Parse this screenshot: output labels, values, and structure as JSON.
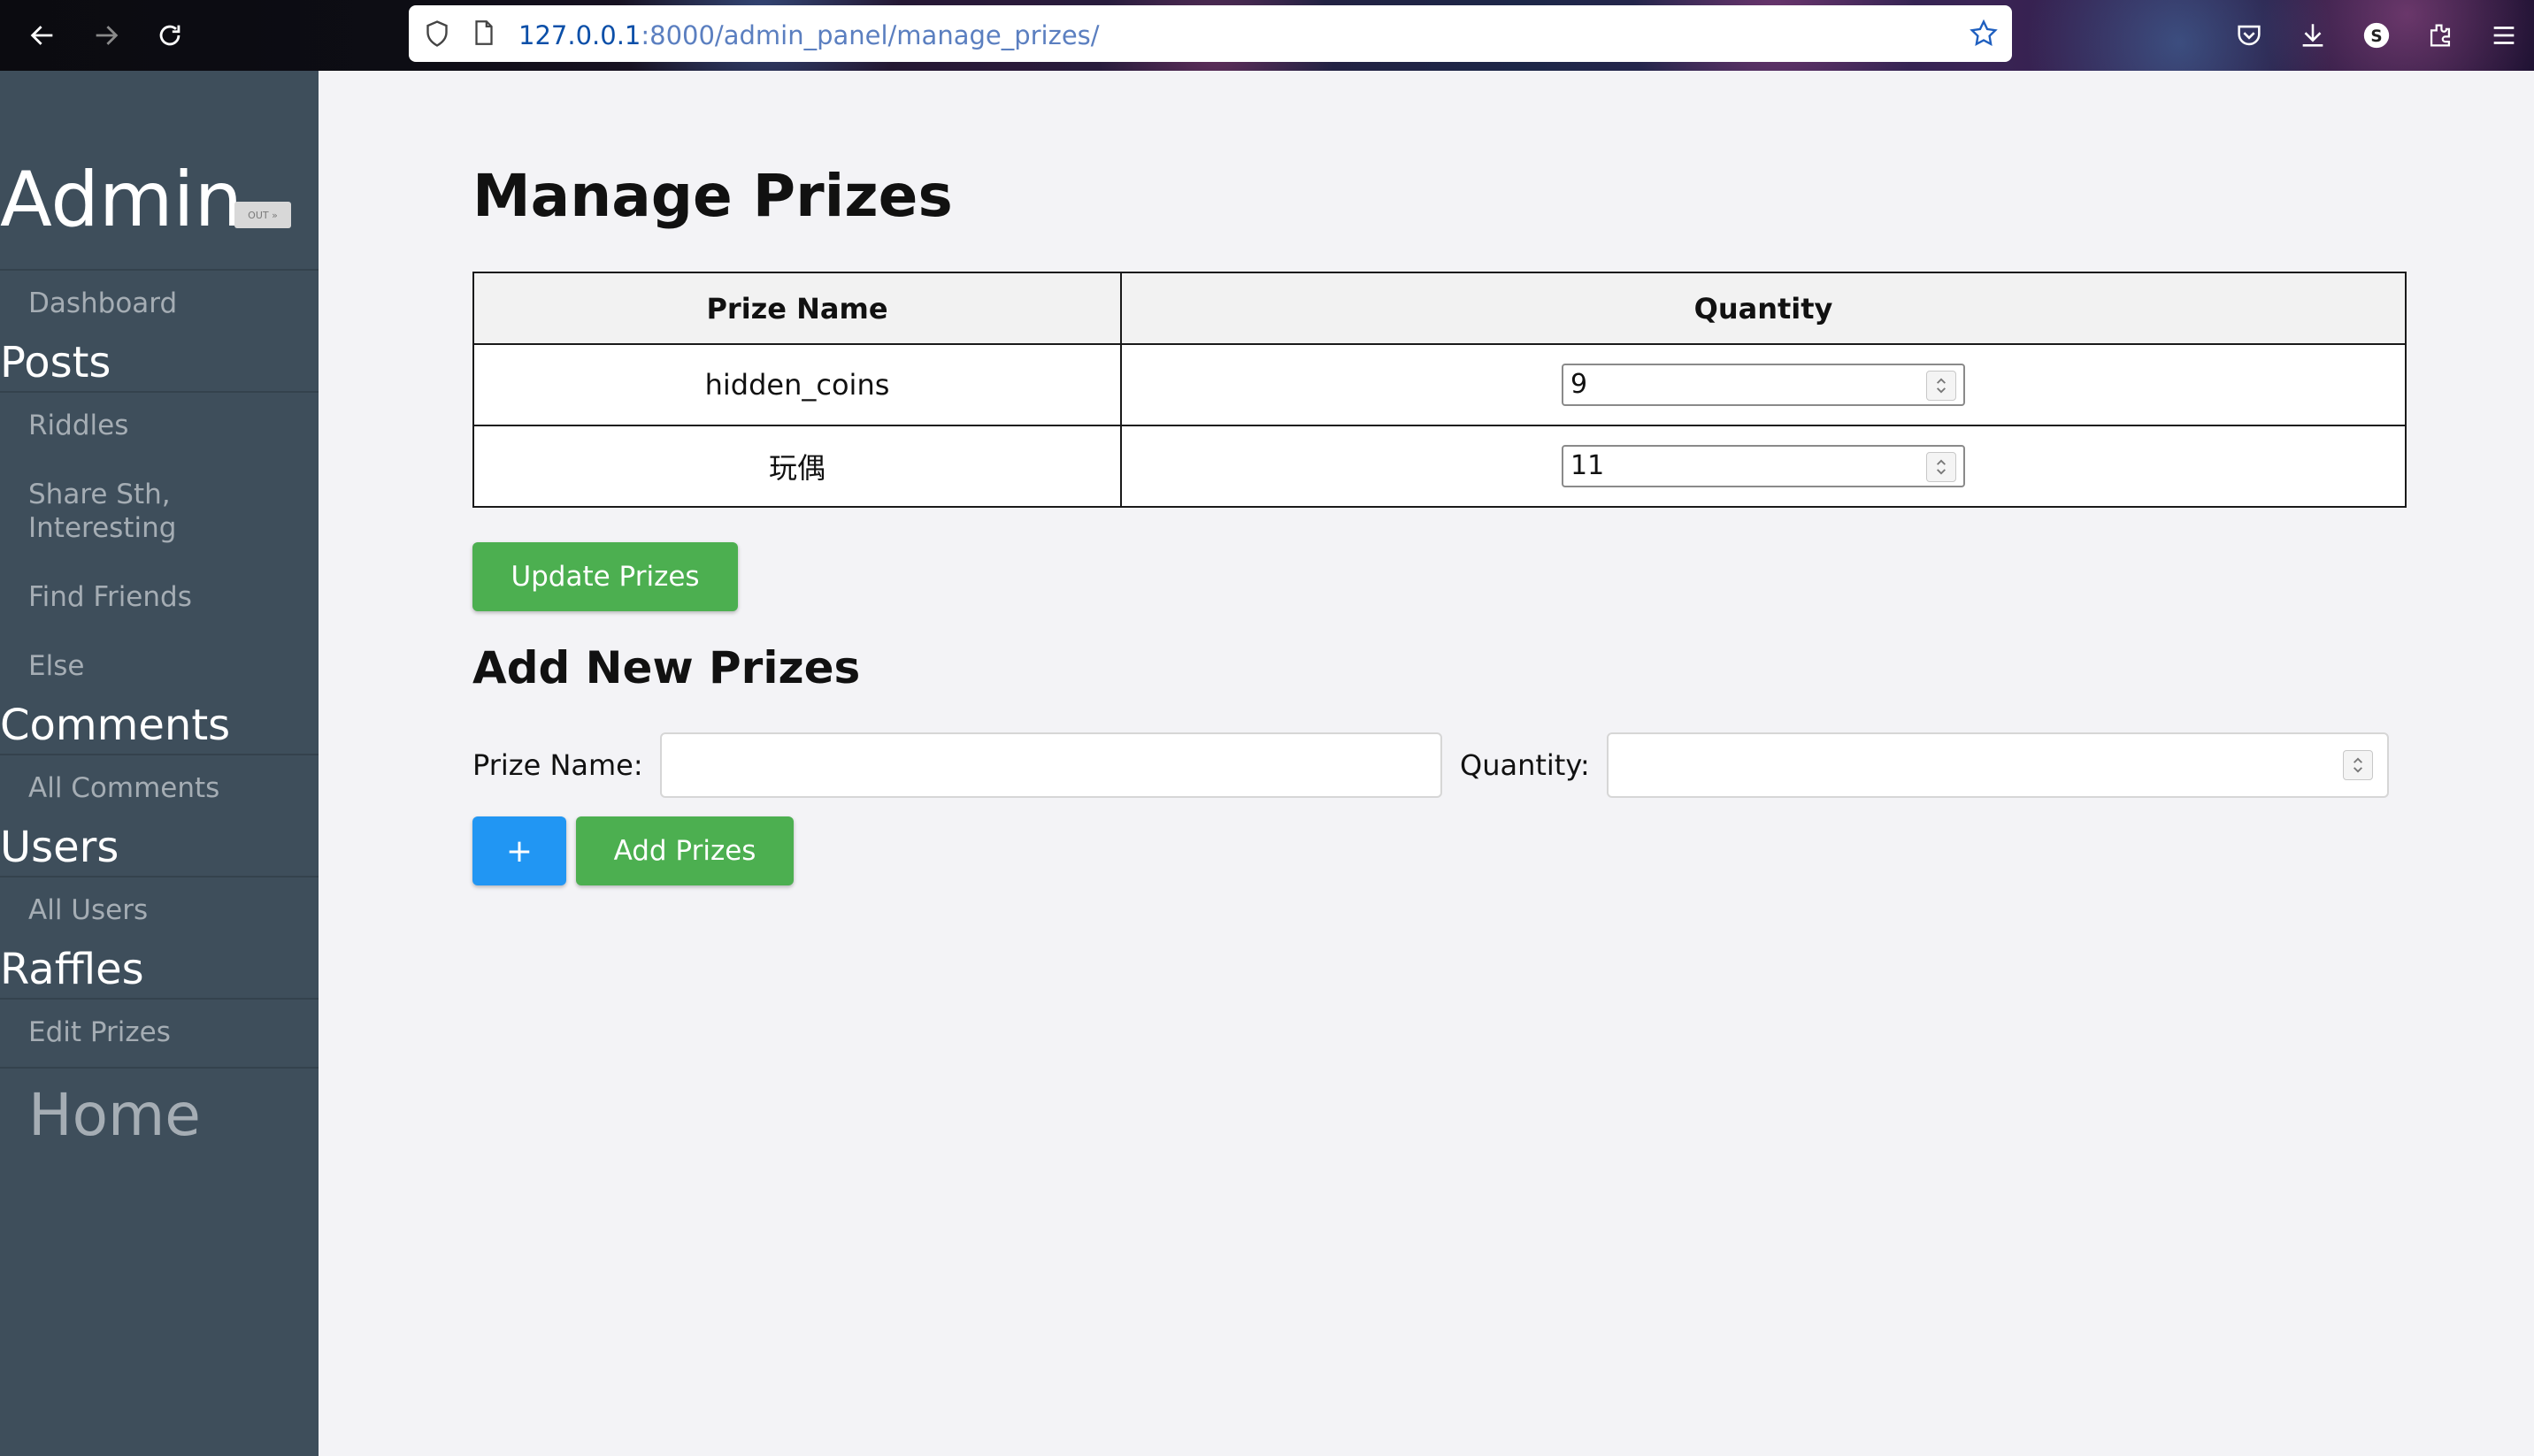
{
  "browser": {
    "url_host": "127.0.0.1",
    "url_rest": ":8000/admin_panel/manage_prizes/",
    "icons": [
      "back-arrow-icon",
      "forward-arrow-icon",
      "reload-icon",
      "shield-icon",
      "page-icon",
      "bookmark-star-icon",
      "pocket-icon",
      "download-icon",
      "account-icon",
      "extensions-icon",
      "menu-icon"
    ]
  },
  "sidebar": {
    "title": "Admin",
    "logout_label": "OUT »",
    "dashboard": "Dashboard",
    "sections": {
      "posts": "Posts",
      "comments": "Comments",
      "users": "Users",
      "raffles": "Raffles"
    },
    "links": {
      "riddles": "Riddles",
      "share": "Share Sth, Interesting",
      "find_friends": "Find Friends",
      "else": "Else",
      "all_comments": "All Comments",
      "all_users": "All Users",
      "edit_prizes": "Edit Prizes"
    },
    "home": "Home"
  },
  "main": {
    "title": "Manage Prizes",
    "table": {
      "headers": [
        "Prize Name",
        "Quantity"
      ],
      "rows": [
        {
          "name": "hidden_coins",
          "quantity": "9"
        },
        {
          "name": "玩偶",
          "quantity": "11"
        }
      ]
    },
    "update_button": "Update Prizes",
    "add_section_title": "Add New Prizes",
    "prize_name_label": "Prize Name:",
    "quantity_label": "Quantity:",
    "prize_name_value": "",
    "quantity_value": "",
    "plus_button": "+",
    "add_button": "Add Prizes"
  },
  "colors": {
    "sidebar_bg": "#3e4e5b",
    "page_bg": "#f3f3f6",
    "green_button": "#4caf50",
    "blue_button": "#2196f3"
  }
}
